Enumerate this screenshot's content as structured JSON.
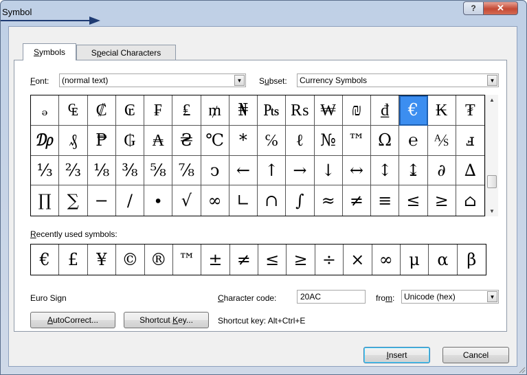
{
  "window": {
    "title": "Symbol",
    "help_label": "?",
    "close_label": "✕"
  },
  "tabs": [
    {
      "label": "Symbols",
      "mnemonic": "S",
      "rest": "ymbols",
      "active": true
    },
    {
      "label": "Special Characters",
      "pre": "S",
      "mnemonic": "p",
      "rest": "ecial Characters",
      "active": false
    }
  ],
  "font": {
    "label_mnemonic": "F",
    "label_rest": "ont:",
    "value": "(normal text)"
  },
  "subset": {
    "label_pre": "S",
    "label_mnemonic": "u",
    "label_rest": "bset:",
    "value": "Currency Symbols"
  },
  "symbol_grid": {
    "rows": [
      [
        "ₔ",
        "₠",
        "₡",
        "₢",
        "₣",
        "₤",
        "₥",
        "₦",
        "₧",
        "₨",
        "₩",
        "₪",
        "₫",
        "€",
        "₭",
        "₮"
      ],
      [
        "₯",
        "₰",
        "₱",
        "₲",
        "₳",
        "₴",
        "℃",
        "*",
        "℅",
        "ℓ",
        "№",
        "™",
        "Ω",
        "℮",
        "⅍",
        "ⅎ"
      ],
      [
        "⅓",
        "⅔",
        "⅛",
        "⅜",
        "⅝",
        "⅞",
        "ↄ",
        "←",
        "↑",
        "→",
        "↓",
        "↔",
        "↕",
        "↨",
        "∂",
        "∆"
      ],
      [
        "∏",
        "∑",
        "−",
        "∕",
        "∙",
        "√",
        "∞",
        "∟",
        "∩",
        "∫",
        "≈",
        "≠",
        "≡",
        "≤",
        "≥",
        "⌂"
      ]
    ],
    "selected": {
      "row": 0,
      "col": 13
    }
  },
  "recent": {
    "label_mnemonic": "R",
    "label_rest": "ecently used symbols:",
    "symbols": [
      "€",
      "£",
      "¥",
      "©",
      "®",
      "™",
      "±",
      "≠",
      "≤",
      "≥",
      "÷",
      "×",
      "∞",
      "μ",
      "α",
      "β"
    ]
  },
  "char_name": "Euro Sign",
  "char_code": {
    "label_mnemonic": "C",
    "label_rest": "haracter code:",
    "value": "20AC"
  },
  "from": {
    "label_pre": "fro",
    "label_mnemonic": "m",
    "label_rest": ":",
    "value": "Unicode (hex)"
  },
  "buttons": {
    "autocorrect_mnemonic": "A",
    "autocorrect_rest": "utoCorrect...",
    "shortcut_pre": "Shortcut ",
    "shortcut_mnemonic": "K",
    "shortcut_rest": "ey...",
    "insert_mnemonic": "I",
    "insert_rest": "nsert",
    "cancel_label": "Cancel"
  },
  "shortcut_text": "Shortcut key: Alt+Ctrl+E"
}
